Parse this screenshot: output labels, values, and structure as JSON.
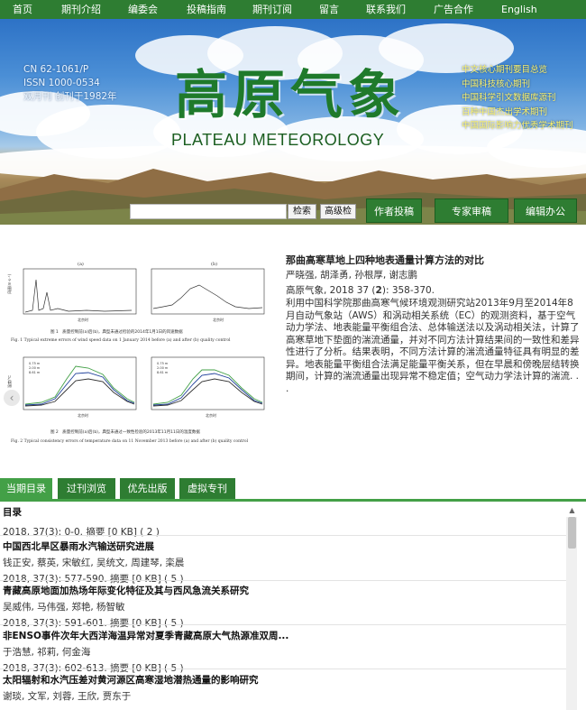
{
  "nav": {
    "items": [
      "首页",
      "期刊介绍",
      "编委会",
      "投稿指南",
      "期刊订阅",
      "留言",
      "联系我们",
      "广告合作",
      "English"
    ]
  },
  "banner": {
    "issn_lines": [
      "CN 62-1061/P",
      "ISSN 1000-0534",
      "双月刊 创刊于1982年"
    ],
    "title_cn": "高原气象",
    "title_en": "PLATEAU METEOROLOGY",
    "index_lines": [
      "中文核心期刊要目总览",
      "中国科技核心期刊",
      "中国科学引文数据库源刊",
      "百种中国杰出学术期刊",
      "中国国际影响力优秀学术期刊"
    ],
    "search_placeholder": "",
    "search_button": "检索",
    "advanced_search_button": "高级检",
    "author_button": "作者投稿",
    "reviewer_button": "专家审稿",
    "editor_button": "编辑办公"
  },
  "featured": {
    "title": "那曲高寒草地上四种地表通量计算方法的对比",
    "authors": "严晓强, 胡泽勇, 孙根厚, 谢志鹏",
    "citation_prefix": "高原气象, 2018 37 (",
    "citation_issue": "2",
    "citation_suffix": "): 358-370.",
    "abstract": "利用中国科学院那曲高寒气候环境观测研究站2013年9月至2014年8月自动气象站（AWS）和涡动相关系统（EC）的观测资料，基于空气动力学法、地表能量平衡组合法、总体输送法以及涡动相关法，计算了高寒草地下垫面的湍流通量，并对不同方法计算结果间的一致性和差异性进行了分析。结果表明，不同方法计算的湍流通量特征具有明显的差异。地表能量平衡组合法满足能量平衡关系，但在早晨和傍晚层结转换期间，计算的湍流通量出现异常不稳定值；空气动力学法计算的湍流. . .",
    "prev_arrow": "‹",
    "figure": {
      "panel_a_label": "(a)",
      "panel_b_label": "(b)",
      "fig1_caption_cn": "图 1　质量控制前(a)后(b)，典型未通过检验的2014年1月1日的风速数据",
      "fig1_caption_en": "Fig. 1   Typical extreme errors of wind speed data on 1 January 2014 before (a) and after (b) quality control",
      "fig2_caption_cn": "图 2　质量控制前(a)后(b)，典型未通过一致性检验的2013年11月11日的温度数据",
      "fig2_caption_en": "Fig. 2   Typical consistency errors of temperature data on 11 November 2013 before (a) and after (b) quality control",
      "x_label": "北京时",
      "y_label_top": "风速(m·s⁻¹)",
      "y_label_bottom": "温度/℃",
      "legend": [
        "0.75 m",
        "2.00 m",
        "8.61 m"
      ]
    }
  },
  "tabs": [
    "当期目录",
    "过刊浏览",
    "优先出版",
    "虚拟专刊"
  ],
  "toc": [
    {
      "title": "目录",
      "authors": "",
      "meta": "2018, 37(3): 0-0.  摘要 [0 KB] ( 2 )"
    },
    {
      "title": "中国西北旱区暴雨水汽输送研究进展",
      "authors": "钱正安, 蔡英, 宋敏红, 吴统文, 周建琴, 栾晨",
      "meta": "2018, 37(3): 577-590.  摘要 [0 KB] ( 5 )"
    },
    {
      "title": "青藏高原地面加热场年际变化特征及其与西风急流关系研究",
      "authors": "吴威伟, 马伟强, 郑艳, 杨智敏",
      "meta": "2018, 37(3): 591-601.  摘要 [0 KB] ( 5 )"
    },
    {
      "title": "非ENSO事件次年大西洋海温异常对夏季青藏高原大气热源准双周...",
      "authors": "于浩慧, 祁莉, 何金海",
      "meta": "2018, 37(3): 602-613.  摘要 [0 KB] ( 5 )"
    },
    {
      "title": "太阳辐射和水汽压差对黄河源区高寒湿地潜热通量的影响研究",
      "authors": "谢琰, 文军, 刘蓉, 王欣, 贾东于",
      "meta": ""
    }
  ],
  "colors": {
    "nav_bg": "#2e7d32",
    "tab_active": "#43a047",
    "title_green": "#1f7a2b",
    "index_yellow": "#fff36b"
  }
}
